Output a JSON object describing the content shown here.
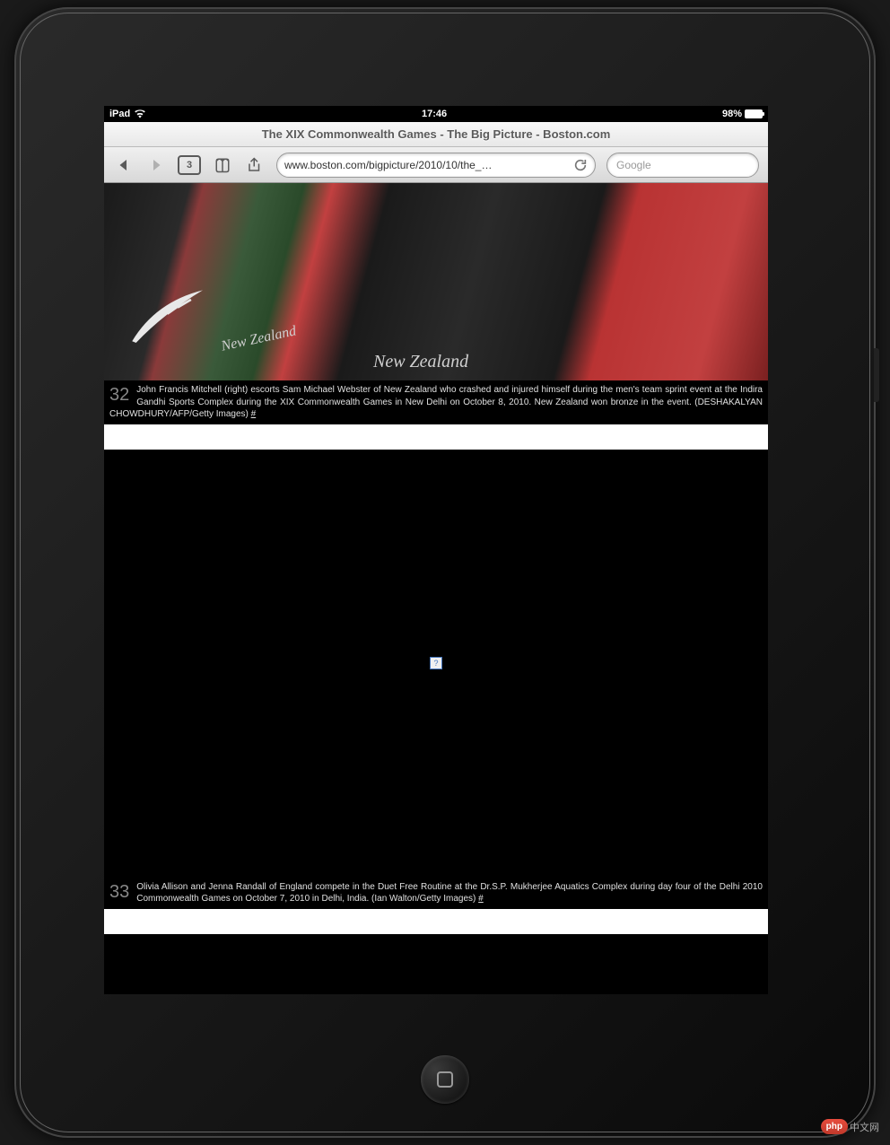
{
  "status": {
    "carrier": "iPad",
    "time": "17:46",
    "battery_percent": "98%"
  },
  "browser": {
    "title": "The XIX Commonwealth Games - The Big Picture - Boston.com",
    "url": "www.boston.com/bigpicture/2010/10/the_…",
    "pages_count": "3",
    "search_placeholder": "Google"
  },
  "captions": [
    {
      "num": "32",
      "text": "John Francis Mitchell (right) escorts Sam Michael Webster of New Zealand who crashed and injured himself during the men's team sprint event at the Indira Gandhi Sports Complex during the XIX Commonwealth Games in New Delhi on October 8, 2010. New Zealand won bronze in the event. (DESHAKALYAN CHOWDHURY/AFP/Getty Images) ",
      "link": "#"
    },
    {
      "num": "33",
      "text": "Olivia Allison and Jenna Randall of England compete in the Duet Free Routine at the Dr.S.P. Mukherjee Aquatics Complex during day four of the Delhi 2010 Commonwealth Games on October 7, 2010 in Delhi, India. (Ian Walton/Getty Images) ",
      "link": "#"
    }
  ],
  "jersey": {
    "text1": "New Zealand",
    "text2": "New Zealand"
  },
  "broken_icon": "?",
  "watermark": {
    "badge": "php",
    "text": "中文网"
  }
}
